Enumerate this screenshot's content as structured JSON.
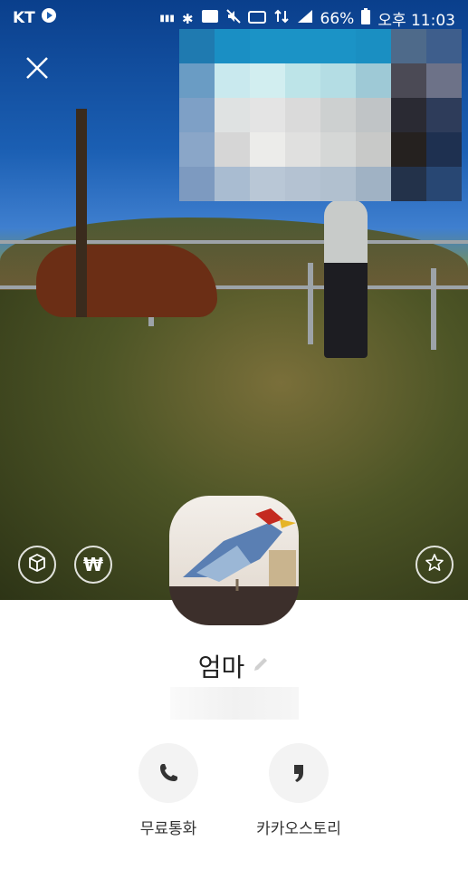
{
  "status_bar": {
    "carrier": "KT",
    "battery": "66%",
    "time": "오후 11:03",
    "icons": [
      "play-icon",
      "hifi-icon",
      "bluetooth-icon",
      "nfc-icon",
      "mute-icon",
      "hd-icon",
      "lte-icon",
      "signal-icon",
      "battery-icon"
    ]
  },
  "header": {
    "close_icon": "close-icon"
  },
  "cover_actions": {
    "gift_icon": "gift-icon",
    "pay_icon": "won-icon",
    "favorite_icon": "star-icon",
    "pay_symbol": "₩"
  },
  "profile": {
    "name": "엄마",
    "edit_icon": "pencil-icon"
  },
  "actions": [
    {
      "label": "무료통화",
      "icon": "phone-icon"
    },
    {
      "label": "카카오스토리",
      "icon": "kakaostory-icon"
    }
  ],
  "colors": {
    "accent": "#f3f3f3",
    "text": "#222222"
  }
}
